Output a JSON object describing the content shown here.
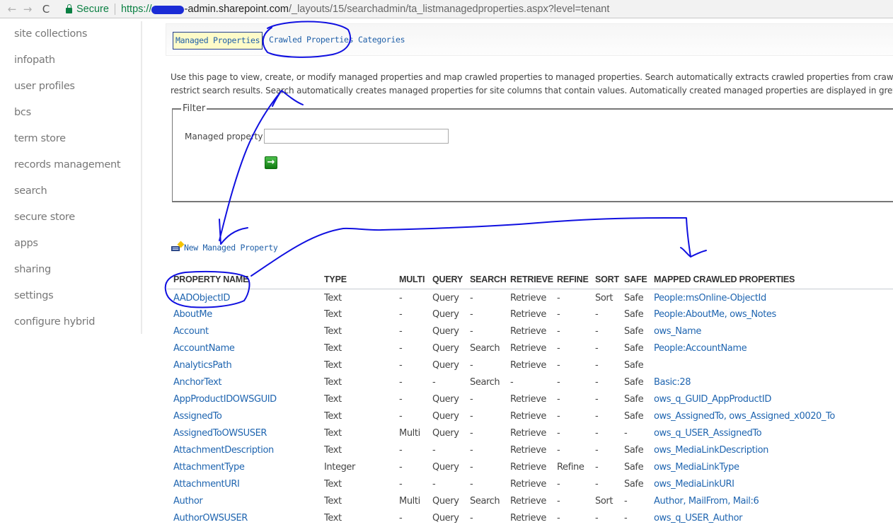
{
  "browser": {
    "back_icon": "←",
    "forward_icon": "→",
    "reload_icon": "C",
    "secure_label": "Secure",
    "url_scheme": "https://",
    "url_host": "-admin.sharepoint.com",
    "url_path": "/_layouts/15/searchadmin/ta_listmanagedproperties.aspx?level=tenant"
  },
  "sidebar": {
    "items": [
      {
        "label": "site collections"
      },
      {
        "label": "infopath"
      },
      {
        "label": "user profiles"
      },
      {
        "label": "bcs"
      },
      {
        "label": "term store"
      },
      {
        "label": "records management"
      },
      {
        "label": "search"
      },
      {
        "label": "secure store"
      },
      {
        "label": "apps"
      },
      {
        "label": "sharing"
      },
      {
        "label": "settings"
      },
      {
        "label": "configure hybrid"
      }
    ]
  },
  "tabs": [
    {
      "label": "Managed Properties",
      "active": true
    },
    {
      "label": "Crawled Properties",
      "active": false
    },
    {
      "label": "Categories",
      "active": false
    }
  ],
  "description": {
    "line1": "Use this page to view, create, or modify managed properties and map crawled properties to managed properties. Search automatically extracts crawled properties from crawled con",
    "line2": "restrict search results. Search automatically creates managed properties for site columns that contain values. Automatically created managed properties are displayed in grey text or"
  },
  "filter": {
    "legend": "Filter",
    "label": "Managed property",
    "value": "",
    "go_icon": "→"
  },
  "new_property": {
    "label": "New Managed Property"
  },
  "table": {
    "headers": [
      "PROPERTY NAME",
      "TYPE",
      "MULTI",
      "QUERY",
      "SEARCH",
      "RETRIEVE",
      "REFINE",
      "SORT",
      "SAFE",
      "MAPPED CRAWLED PROPERTIES"
    ],
    "rows": [
      [
        "AADObjectID",
        "Text",
        "-",
        "Query",
        "-",
        "Retrieve",
        "-",
        "Sort",
        "Safe",
        "People:msOnline-ObjectId"
      ],
      [
        "AboutMe",
        "Text",
        "-",
        "Query",
        "-",
        "Retrieve",
        "-",
        "-",
        "Safe",
        "People:AboutMe, ows_Notes"
      ],
      [
        "Account",
        "Text",
        "-",
        "Query",
        "-",
        "Retrieve",
        "-",
        "-",
        "Safe",
        "ows_Name"
      ],
      [
        "AccountName",
        "Text",
        "-",
        "Query",
        "Search",
        "Retrieve",
        "-",
        "-",
        "Safe",
        "People:AccountName"
      ],
      [
        "AnalyticsPath",
        "Text",
        "-",
        "Query",
        "-",
        "Retrieve",
        "-",
        "-",
        "Safe",
        ""
      ],
      [
        "AnchorText",
        "Text",
        "-",
        "-",
        "Search",
        "-",
        "-",
        "-",
        "Safe",
        "Basic:28"
      ],
      [
        "AppProductIDOWSGUID",
        "Text",
        "-",
        "Query",
        "-",
        "Retrieve",
        "-",
        "-",
        "Safe",
        "ows_q_GUID_AppProductID"
      ],
      [
        "AssignedTo",
        "Text",
        "-",
        "Query",
        "-",
        "Retrieve",
        "-",
        "-",
        "Safe",
        "ows_AssignedTo, ows_Assigned_x0020_To"
      ],
      [
        "AssignedToOWSUSER",
        "Text",
        "Multi",
        "Query",
        "-",
        "Retrieve",
        "-",
        "-",
        "-",
        "ows_q_USER_AssignedTo"
      ],
      [
        "AttachmentDescription",
        "Text",
        "-",
        "-",
        "-",
        "Retrieve",
        "-",
        "-",
        "Safe",
        "ows_MediaLinkDescription"
      ],
      [
        "AttachmentType",
        "Integer",
        "-",
        "Query",
        "-",
        "Retrieve",
        "Refine",
        "-",
        "Safe",
        "ows_MediaLinkType"
      ],
      [
        "AttachmentURI",
        "Text",
        "-",
        "-",
        "-",
        "Retrieve",
        "-",
        "-",
        "Safe",
        "ows_MediaLinkURI"
      ],
      [
        "Author",
        "Text",
        "Multi",
        "Query",
        "Search",
        "Retrieve",
        "-",
        "Sort",
        "-",
        "Author, MailFrom, Mail:6"
      ],
      [
        "AuthorOWSUSER",
        "Text",
        "-",
        "Query",
        "-",
        "Retrieve",
        "-",
        "-",
        "-",
        "ows_q_USER_Author"
      ]
    ]
  },
  "colors": {
    "link": "#1f65b0",
    "annotation_ink": "#1010e0",
    "active_tab_bg": "#fefbc8"
  }
}
